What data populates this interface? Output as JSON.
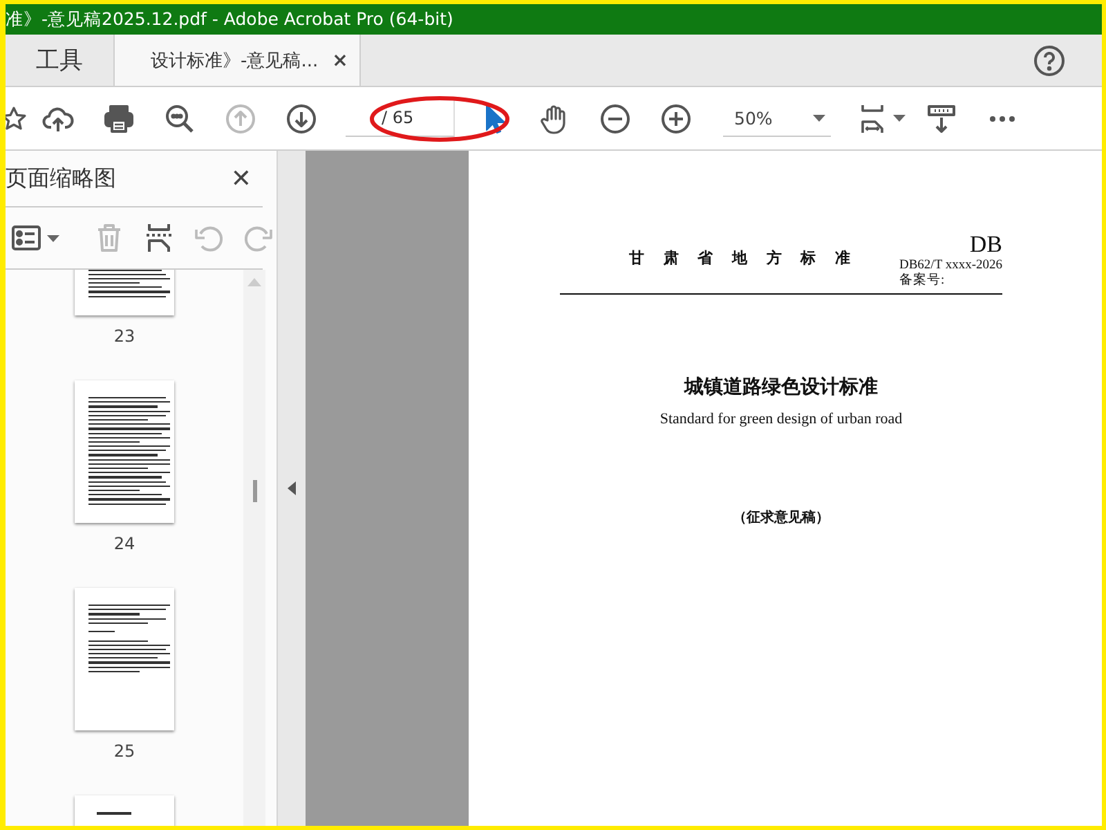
{
  "window": {
    "title": "准》-意见稿2025.12.pdf - Adobe Acrobat Pro (64-bit)"
  },
  "tabs": [
    {
      "label": "工具",
      "selected": false
    },
    {
      "label": "设计标准》-意见稿...",
      "selected": true,
      "close": "×"
    }
  ],
  "toolbar": {
    "left_buttons": [
      {
        "kind": "star",
        "disabled": false
      },
      {
        "kind": "upload",
        "disabled": false
      },
      {
        "kind": "print",
        "disabled": false
      },
      {
        "kind": "search",
        "disabled": false
      },
      {
        "kind": "up",
        "disabled": true
      },
      {
        "kind": "down",
        "disabled": false
      }
    ],
    "page_field": {
      "total": "/ 65"
    },
    "tool_buttons": [
      {
        "kind": "pointer",
        "selected": true
      },
      {
        "kind": "hand",
        "selected": false
      },
      {
        "kind": "minus",
        "selected": false
      },
      {
        "kind": "plus",
        "selected": false
      }
    ],
    "zoom": {
      "value": "50%"
    },
    "right_buttons": [
      {
        "kind": "fit"
      },
      {
        "kind": "ruler"
      },
      {
        "kind": "more"
      }
    ]
  },
  "side_panel": {
    "title": "页面缩略图",
    "close": "✕",
    "tools": [
      {
        "kind": "options",
        "disabled": false
      },
      {
        "kind": "trash",
        "disabled": true
      },
      {
        "kind": "insert",
        "disabled": false
      },
      {
        "kind": "undo",
        "disabled": true
      },
      {
        "kind": "redo",
        "disabled": true
      }
    ],
    "thumbnails": [
      {
        "kind": "text",
        "label": "23"
      },
      {
        "kind": "text",
        "label": "24"
      },
      {
        "kind": "half",
        "label": "25"
      },
      {
        "kind": "heading"
      }
    ]
  },
  "document": {
    "header": "甘 肃 省 地 方 标 准",
    "code": "DB",
    "number": "DB62/T xxxx-2026",
    "record": "备案号:",
    "title": "城镇道路绿色设计标准",
    "subtitle": "Standard for green design of urban road",
    "status": "（征求意见稿）"
  }
}
